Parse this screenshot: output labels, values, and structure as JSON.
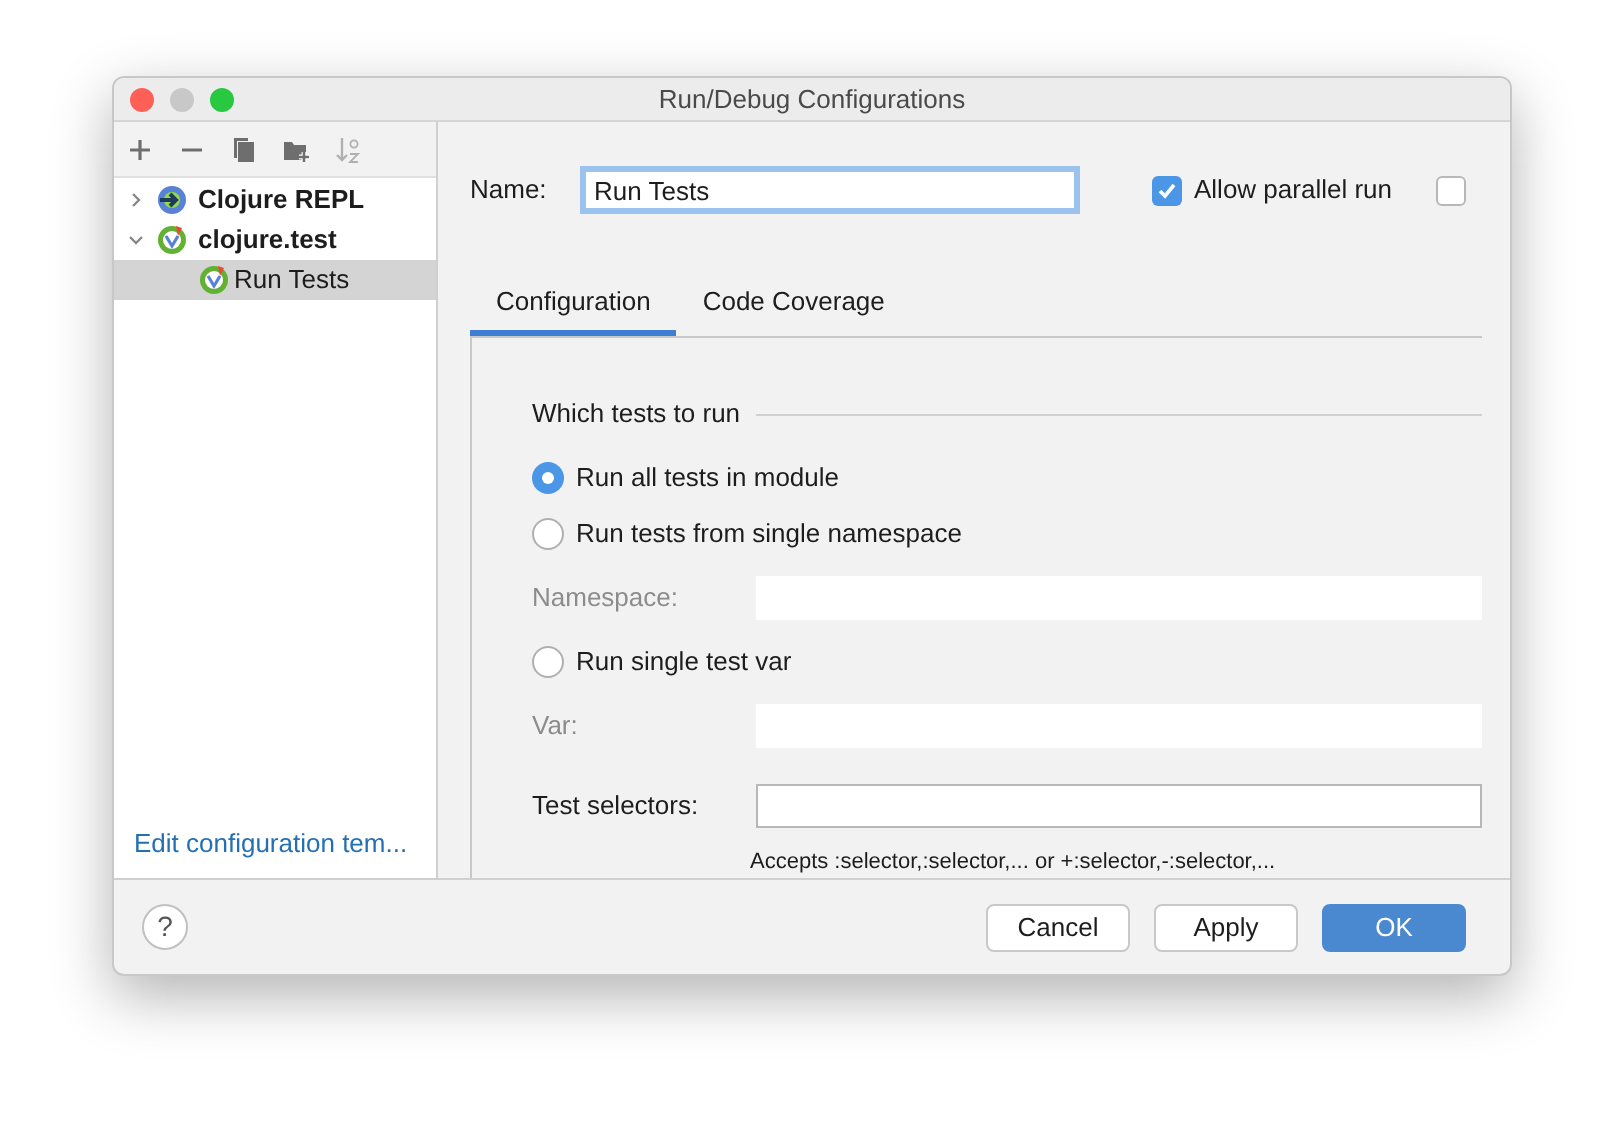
{
  "window": {
    "title": "Run/Debug Configurations"
  },
  "sidebar": {
    "toolbar": [
      {
        "kind": "add"
      },
      {
        "kind": "remove"
      },
      {
        "kind": "copy"
      },
      {
        "kind": "folder"
      },
      {
        "kind": "sort",
        "disabled": true
      }
    ],
    "tree": [
      {
        "label": "Clojure REPL",
        "kind": "repl",
        "expanded": false,
        "selected": false
      },
      {
        "label": "clojure.test",
        "kind": "test",
        "expanded": true,
        "selected": false,
        "children": [
          {
            "label": "Run Tests",
            "kind": "test",
            "selected": true
          }
        ]
      }
    ],
    "footer_link": "Edit configuration tem..."
  },
  "name": {
    "label": "Name:",
    "value": "Run Tests"
  },
  "options": [
    {
      "label": "Allow parallel run",
      "checked": true
    },
    {
      "checked": false
    }
  ],
  "tabs": [
    {
      "label": "Configuration",
      "selected": true
    },
    {
      "label": "Code Coverage",
      "selected": false
    }
  ],
  "section": {
    "title": "Which tests to run"
  },
  "rows": [
    {
      "kind": "radio",
      "label": "Run all tests in module",
      "selected": true
    },
    {
      "kind": "radio",
      "label": "Run tests from single namespace",
      "selected": false
    },
    {
      "kind": "field",
      "label": "Namespace:",
      "disabled": true
    },
    {
      "kind": "radio",
      "label": "Run single test var",
      "selected": false
    },
    {
      "kind": "field",
      "label": "Var:",
      "disabled": true
    },
    {
      "kind": "field",
      "label": "Test selectors:",
      "disabled": false
    }
  ],
  "hint": "Accepts :selector,:selector,... or +:selector,-:selector,...",
  "buttons": [
    {
      "label": "Cancel",
      "primary": false
    },
    {
      "label": "Apply",
      "primary": false
    },
    {
      "label": "OK",
      "primary": true
    }
  ],
  "help": "?"
}
